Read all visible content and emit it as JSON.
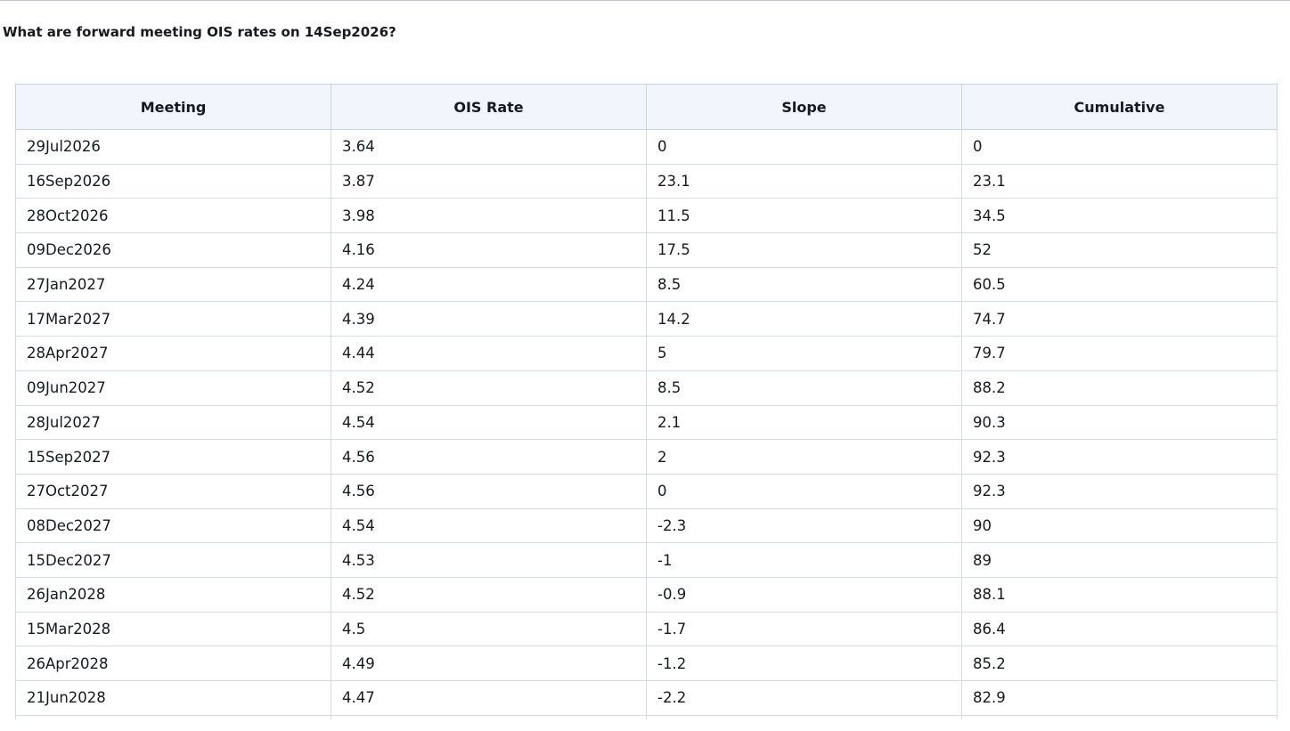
{
  "question": "What are forward meeting OIS rates on 14Sep2026?",
  "table": {
    "headers": [
      "Meeting",
      "OIS Rate",
      "Slope",
      "Cumulative"
    ],
    "rows": [
      [
        "29Jul2026",
        "3.64",
        "0",
        "0"
      ],
      [
        "16Sep2026",
        "3.87",
        "23.1",
        "23.1"
      ],
      [
        "28Oct2026",
        "3.98",
        "11.5",
        "34.5"
      ],
      [
        "09Dec2026",
        "4.16",
        "17.5",
        "52"
      ],
      [
        "27Jan2027",
        "4.24",
        "8.5",
        "60.5"
      ],
      [
        "17Mar2027",
        "4.39",
        "14.2",
        "74.7"
      ],
      [
        "28Apr2027",
        "4.44",
        "5",
        "79.7"
      ],
      [
        "09Jun2027",
        "4.52",
        "8.5",
        "88.2"
      ],
      [
        "28Jul2027",
        "4.54",
        "2.1",
        "90.3"
      ],
      [
        "15Sep2027",
        "4.56",
        "2",
        "92.3"
      ],
      [
        "27Oct2027",
        "4.56",
        "0",
        "92.3"
      ],
      [
        "08Dec2027",
        "4.54",
        "-2.3",
        "90"
      ],
      [
        "15Dec2027",
        "4.53",
        "-1",
        "89"
      ],
      [
        "26Jan2028",
        "4.52",
        "-0.9",
        "88.1"
      ],
      [
        "15Mar2028",
        "4.5",
        "-1.7",
        "86.4"
      ],
      [
        "26Apr2028",
        "4.49",
        "-1.2",
        "85.2"
      ],
      [
        "21Jun2028",
        "4.47",
        "-2.2",
        "82.9"
      ],
      [
        "",
        "",
        "",
        ""
      ]
    ]
  }
}
